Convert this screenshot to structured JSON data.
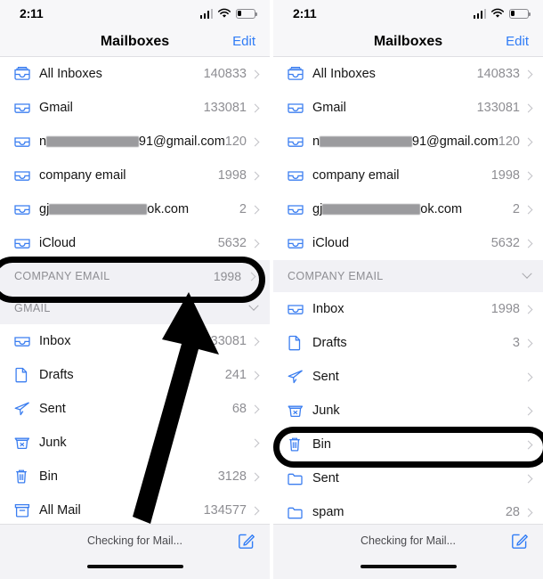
{
  "status": {
    "time": "2:11",
    "signal_icon": "cellular-signal-icon",
    "wifi_icon": "wifi-icon",
    "battery_icon": "battery-low-icon"
  },
  "nav": {
    "title": "Mailboxes",
    "edit_label": "Edit"
  },
  "accounts": [
    {
      "label": "All Inboxes",
      "count": "140833",
      "icon": "all-inboxes-tray-icon",
      "redacted": false
    },
    {
      "label": "Gmail",
      "count": "133081",
      "icon": "inbox-tray-icon",
      "redacted": false
    },
    {
      "label_prefix": "n",
      "label_suffix": "91@gmail.com",
      "count": "120",
      "icon": "inbox-tray-icon",
      "redacted": true,
      "redact_width": 118
    },
    {
      "label": "company email",
      "count": "1998",
      "icon": "inbox-tray-icon",
      "redacted": false
    },
    {
      "label_prefix": "gj",
      "label_suffix": "ok.com",
      "count": "2",
      "icon": "inbox-tray-icon",
      "redacted": true,
      "redact_width": 110
    },
    {
      "label": "iCloud",
      "count": "5632",
      "icon": "inbox-tray-icon",
      "redacted": false
    }
  ],
  "left_panel": {
    "section_company": {
      "title": "COMPANY EMAIL",
      "count": "1998"
    },
    "section_gmail": {
      "title": "GMAIL"
    },
    "gmail_items": [
      {
        "label": "Inbox",
        "count": "133081",
        "icon": "inbox-tray-icon"
      },
      {
        "label": "Drafts",
        "count": "241",
        "icon": "drafts-page-icon"
      },
      {
        "label": "Sent",
        "count": "68",
        "icon": "sent-paperplane-icon"
      },
      {
        "label": "Junk",
        "count": "",
        "icon": "junk-basket-icon"
      },
      {
        "label": "Bin",
        "count": "3128",
        "icon": "trash-bin-icon"
      },
      {
        "label": "All Mail",
        "count": "134577",
        "icon": "archive-box-icon"
      }
    ],
    "highlight_target": "COMPANY EMAIL section header",
    "arrow_annotation": "arrow pointing up to company email section"
  },
  "right_panel": {
    "section_company": {
      "title": "COMPANY EMAIL"
    },
    "company_items": [
      {
        "label": "Inbox",
        "count": "1998",
        "icon": "inbox-tray-icon"
      },
      {
        "label": "Drafts",
        "count": "3",
        "icon": "drafts-page-icon"
      },
      {
        "label": "Sent",
        "count": "",
        "icon": "sent-paperplane-icon"
      },
      {
        "label": "Junk",
        "count": "",
        "icon": "junk-basket-icon"
      },
      {
        "label": "Bin",
        "count": "",
        "icon": "trash-bin-icon"
      },
      {
        "label": "Sent",
        "count": "",
        "icon": "folder-icon"
      },
      {
        "label": "spam",
        "count": "28",
        "icon": "folder-icon"
      }
    ],
    "highlight_target": "Bin row"
  },
  "toolbar": {
    "status_text": "Checking for Mail...",
    "compose_icon": "compose-pencil-icon"
  },
  "colors": {
    "accent": "#2f7cf6",
    "icon_blue": "#3b7ef0",
    "count_gray": "#8e8e93",
    "section_bg": "#f1f1f5",
    "chrome_bg": "#f7f7f9",
    "highlight": "#000000"
  }
}
